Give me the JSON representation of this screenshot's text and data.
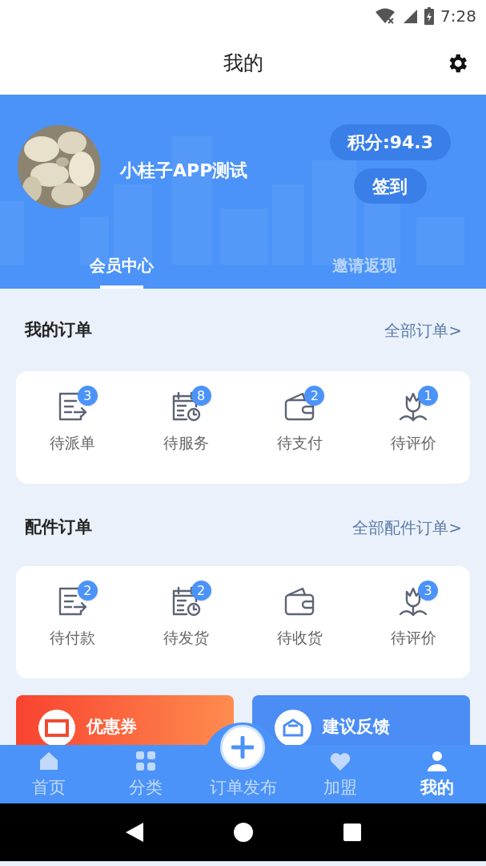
{
  "status_bar": {
    "time": "7:28"
  },
  "header": {
    "title": "我的"
  },
  "profile": {
    "name": "小桂子APP测试",
    "points": "积分:94.3",
    "sign_in": "签到"
  },
  "tabs": [
    {
      "label": "会员中心",
      "selected": true
    },
    {
      "label": "邀请返现",
      "selected": false
    }
  ],
  "sections": [
    {
      "title": "我的订单",
      "link": "全部订单>",
      "items": [
        {
          "kind": "list",
          "label": "待派单",
          "badge": "3"
        },
        {
          "kind": "calendar",
          "label": "待服务",
          "badge": "8"
        },
        {
          "kind": "wallet",
          "label": "待支付",
          "badge": "2"
        },
        {
          "kind": "tulip",
          "label": "待评价",
          "badge": "1"
        }
      ]
    },
    {
      "title": "配件订单",
      "link": "全部配件订单>",
      "items": [
        {
          "kind": "list",
          "label": "待付款",
          "badge": "2"
        },
        {
          "kind": "calendar",
          "label": "待发货",
          "badge": "2"
        },
        {
          "kind": "wallet",
          "label": "待收货"
        },
        {
          "kind": "tulip",
          "label": "待评价",
          "badge": "3"
        }
      ]
    }
  ],
  "promo_cards": [
    {
      "kind": "coupon",
      "label": "优惠券"
    },
    {
      "kind": "feedback",
      "label": "建议反馈"
    }
  ],
  "bottom_nav": [
    {
      "kind": "home",
      "label": "首页",
      "selected": false
    },
    {
      "kind": "grid",
      "label": "分类",
      "selected": false
    },
    {
      "kind": "publish",
      "label": "订单发布",
      "selected": false
    },
    {
      "kind": "handshake",
      "label": "加盟",
      "selected": false
    },
    {
      "kind": "person",
      "label": "我的",
      "selected": true
    }
  ]
}
